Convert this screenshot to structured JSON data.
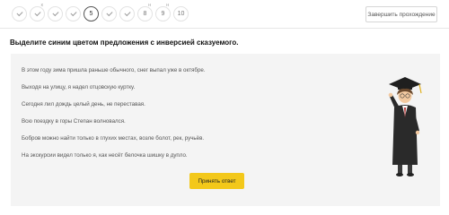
{
  "steps": [
    {
      "label": "",
      "state": "done",
      "mark": ""
    },
    {
      "label": "",
      "state": "done",
      "mark": "х"
    },
    {
      "label": "",
      "state": "done",
      "mark": ""
    },
    {
      "label": "",
      "state": "done",
      "mark": ""
    },
    {
      "label": "5",
      "state": "current",
      "mark": ""
    },
    {
      "label": "",
      "state": "done",
      "mark": ""
    },
    {
      "label": "",
      "state": "done",
      "mark": ""
    },
    {
      "label": "8",
      "state": "pending",
      "mark": "н"
    },
    {
      "label": "9",
      "state": "pending",
      "mark": "н"
    },
    {
      "label": "10",
      "state": "pending",
      "mark": ""
    }
  ],
  "finish_label": "Завершить прохождение",
  "task": {
    "title": "Выделите синим цветом предложения с инверсией сказуемого.",
    "sentences": [
      "В этом году зима пришла раньше обычного, снег выпал уже в октябре.",
      "Выходя на улицу, я надел отцовскую куртку.",
      "Сегодня лил дождь целый день, не переставая.",
      "Всю поездку в горы Степан волновался.",
      "Бобров можно найти только в глухих местах, возле болот, рек, ручьёв.",
      "На экскурсии видел только я, как несёт белочка шишку в дупло."
    ],
    "submit_label": "Принять ответ"
  },
  "colors": {
    "accent_button": "#f3c81a",
    "panel_bg": "#f4f4f4"
  }
}
